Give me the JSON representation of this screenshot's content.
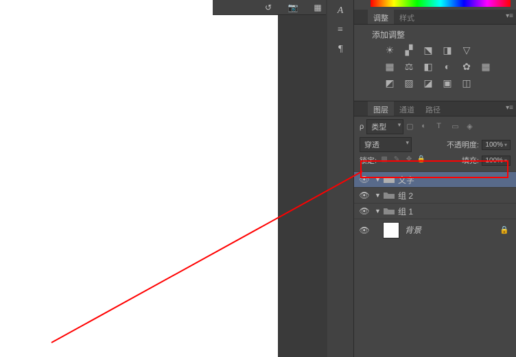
{
  "adjustments": {
    "tab_label": "调整",
    "tab2_label": "样式",
    "title": "添加调整"
  },
  "layers": {
    "tab_layers": "图层",
    "tab_channels": "通道",
    "tab_paths": "路径",
    "kind_label": "类型",
    "blend_mode": "穿透",
    "opacity_label": "不透明度:",
    "opacity_value": "100%",
    "lock_label": "锁定:",
    "fill_label": "填充:",
    "fill_value": "100%",
    "items": [
      {
        "name": "文字"
      },
      {
        "name": "组 2"
      },
      {
        "name": "组 1"
      },
      {
        "name": "背景"
      }
    ]
  }
}
